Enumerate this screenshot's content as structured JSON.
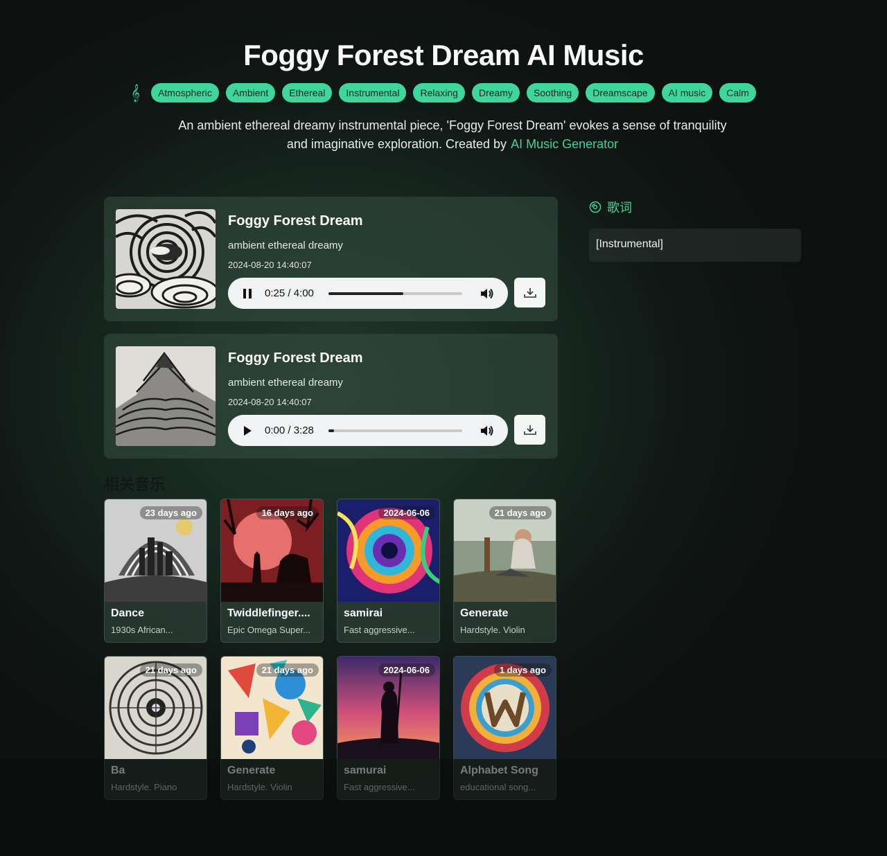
{
  "header": {
    "title": "Foggy Forest Dream AI Music",
    "tags": [
      "Atmospheric",
      "Ambient",
      "Ethereal",
      "Instrumental",
      "Relaxing",
      "Dreamy",
      "Soothing",
      "Dreamscape",
      "AI music",
      "Calm"
    ],
    "intro_line1": "An ambient ethereal dreamy instrumental piece, 'Foggy Forest Dream' evokes a sense of tranquility",
    "intro_line2": "and imaginative exploration. Created by",
    "intro_link": "AI Music Generator"
  },
  "tracks": [
    {
      "title": "Foggy Forest Dream",
      "style": "ambient ethereal dreamy",
      "date": "2024-08-20 14:40:07",
      "time": "0:25 / 4:00",
      "state": "playing",
      "progress": 0.56
    },
    {
      "title": "Foggy Forest Dream",
      "style": "ambient ethereal dreamy",
      "date": "2024-08-20 14:40:07",
      "time": "0:00 / 3:28",
      "state": "paused",
      "progress": 0.04
    }
  ],
  "lyrics": {
    "heading": "歌词",
    "content": "[Instrumental]"
  },
  "related": {
    "heading": "相关音乐",
    "items": [
      {
        "badge": "23 days ago",
        "title": "Dance",
        "subtitle": "1930s African..."
      },
      {
        "badge": "16 days ago",
        "title": "Twiddlefinger....",
        "subtitle": "Epic Omega Super..."
      },
      {
        "badge": "2024-06-06",
        "title": "samirai",
        "subtitle": "Fast aggressive..."
      },
      {
        "badge": "21 days ago",
        "title": "Generate",
        "subtitle": "Hardstyle. Violin"
      },
      {
        "badge": "21 days ago",
        "title": "Ba",
        "subtitle": "Hardstyle. Piano"
      },
      {
        "badge": "21 days ago",
        "title": "Generate",
        "subtitle": "Hardstyle. Violin"
      },
      {
        "badge": "2024-06-06",
        "title": "samurai",
        "subtitle": "Fast aggressive..."
      },
      {
        "badge": "1 days ago",
        "title": "Alphabet Song",
        "subtitle": "educational song..."
      }
    ]
  },
  "colors": {
    "accent": "#3ed69c",
    "background": "#142019"
  }
}
